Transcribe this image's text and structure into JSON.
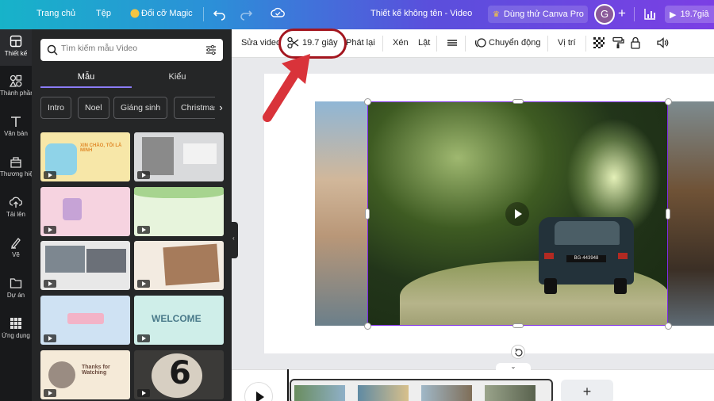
{
  "topbar": {
    "home": "Trang chủ",
    "file": "Tệp",
    "magic": "Đổi cỡ Magic",
    "doc_title": "Thiết kế không tên - Video",
    "pro": "Dùng thử Canva Pro",
    "avatar_initial": "G",
    "present": "19.7giâ"
  },
  "rail": [
    {
      "label": "Thiết kế",
      "icon": "layout-icon"
    },
    {
      "label": "Thành phần",
      "icon": "elements-icon"
    },
    {
      "label": "Văn bản",
      "icon": "text-icon"
    },
    {
      "label": "Thương hiệu",
      "icon": "brand-icon"
    },
    {
      "label": "Tải lên",
      "icon": "upload-icon"
    },
    {
      "label": "Vẽ",
      "icon": "draw-icon"
    },
    {
      "label": "Dự án",
      "icon": "folder-icon"
    },
    {
      "label": "Ứng dụng",
      "icon": "apps-icon"
    }
  ],
  "panel": {
    "search_placeholder": "Tìm kiếm mẫu Video",
    "tab_templates": "Mẫu",
    "tab_styles": "Kiểu",
    "chips": [
      "Intro",
      "Noel",
      "Giáng sinh",
      "Christmas"
    ],
    "tiles": [
      {
        "caption": "XIN CHÀO, TÔI LÀ MINH",
        "bg": "#f7e7a8"
      },
      {
        "caption": "",
        "bg": "#d9dadc"
      },
      {
        "caption": "",
        "bg": "#f6d3e0"
      },
      {
        "caption": "",
        "bg": "#e7f4dc"
      },
      {
        "caption": "",
        "bg": "#e8e8e8"
      },
      {
        "caption": "",
        "bg": "#f3ebe1"
      },
      {
        "caption": "",
        "bg": "#cfe2f3"
      },
      {
        "caption": "WELCOME",
        "bg": "#cfeee9"
      },
      {
        "caption": "Thanks for Watching",
        "bg": "#f5ead8"
      },
      {
        "caption": "6",
        "bg": "#3b3a38"
      }
    ]
  },
  "ctx": {
    "edit_video": "Sửa video",
    "duration": "19.7 giây",
    "playback": "Phát lại",
    "crop": "Xén",
    "flip": "Lật",
    "animate": "Chuyển động",
    "position": "Vị trí"
  },
  "video": {
    "plate": "BG·443948"
  },
  "timeline": {
    "add": "+"
  },
  "colors": {
    "accent": "#7d2ae8",
    "highlight": "#a3161f",
    "arrow": "#d9333a"
  }
}
